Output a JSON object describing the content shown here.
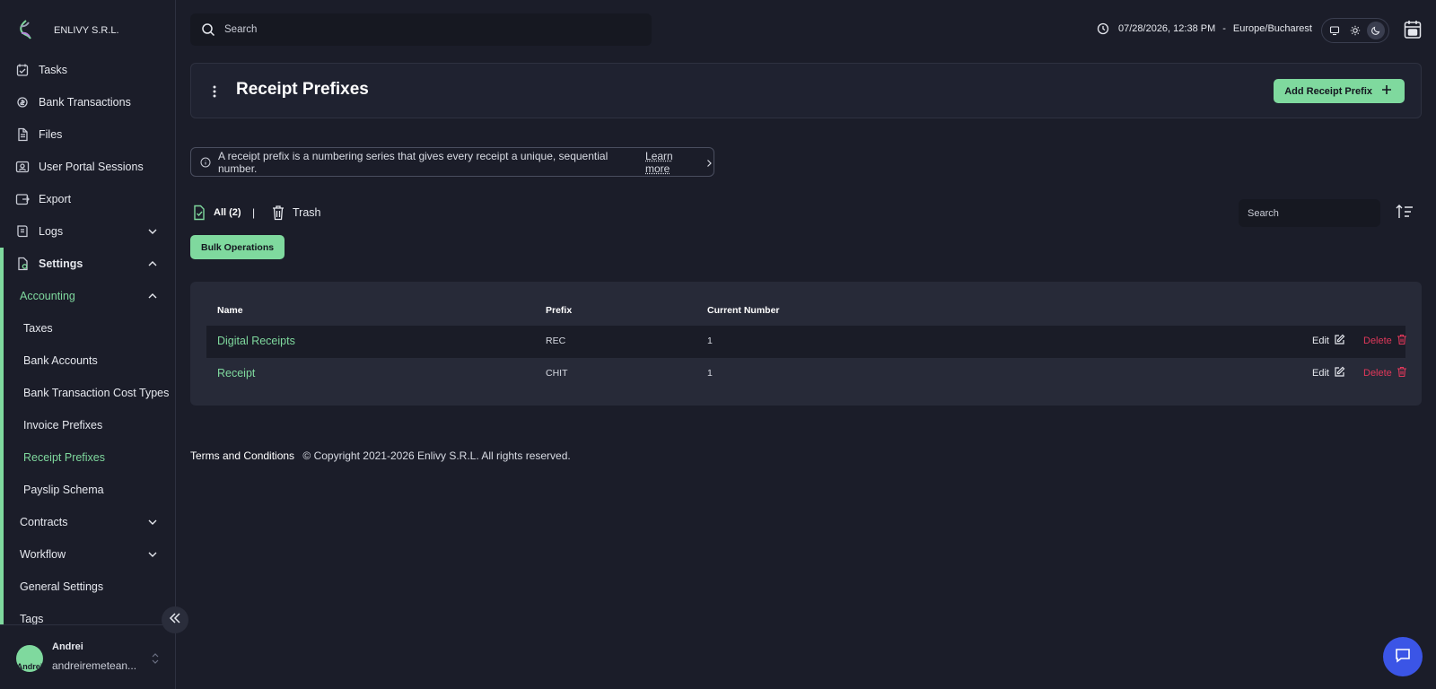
{
  "brand": {
    "name": "ENLIVY S.R.L."
  },
  "sidebar": {
    "items": [
      {
        "label": "Tasks",
        "icon": "tasks-icon"
      },
      {
        "label": "Bank Transactions",
        "icon": "bank-transactions-icon"
      },
      {
        "label": "Files",
        "icon": "file-icon"
      },
      {
        "label": "User Portal Sessions",
        "icon": "user-portal-icon"
      },
      {
        "label": "Export",
        "icon": "export-icon"
      },
      {
        "label": "Logs",
        "icon": "logs-icon"
      },
      {
        "label": "Settings",
        "icon": "settings-icon"
      }
    ],
    "settings_children": {
      "accounting": "Accounting",
      "accounting_items": [
        "Taxes",
        "Bank Accounts",
        "Bank Transaction Cost Types",
        "Invoice Prefixes",
        "Receipt Prefixes",
        "Payslip Schema"
      ],
      "contracts": "Contracts",
      "workflow": "Workflow",
      "general_settings": "General Settings",
      "tags": "Tags"
    },
    "active_item": "Receipt Prefixes"
  },
  "user": {
    "name": "Andrei",
    "email": "andreiremetean...",
    "avatar_text": "Andrei"
  },
  "topbar": {
    "search_placeholder": "Search",
    "datetime": "07/28/2026, 12:38 PM",
    "separator": "-",
    "timezone": "Europe/Bucharest",
    "theme_selected": "dark"
  },
  "page": {
    "title": "Receipt Prefixes",
    "add_button": "Add Receipt Prefix",
    "info_text": "A receipt prefix is a numbering series that gives every receipt a unique, sequential number.",
    "learn_more": "Learn more"
  },
  "filters": {
    "all_label": "All (2)",
    "separator": "|",
    "trash_label": "Trash",
    "search_placeholder": "Search",
    "bulk_button": "Bulk Operations"
  },
  "table": {
    "columns": [
      "Name",
      "Prefix",
      "Current Number"
    ],
    "rows": [
      {
        "name": "Digital Receipts",
        "prefix": "REC",
        "current_number": "1"
      },
      {
        "name": "Receipt",
        "prefix": "CHIT",
        "current_number": "1"
      }
    ],
    "edit_label": "Edit",
    "delete_label": "Delete"
  },
  "footer": {
    "terms": "Terms and Conditions",
    "copyright": "© Copyright 2021-2026 Enlivy S.R.L. All rights reserved."
  },
  "colors": {
    "accent": "#7fd99e",
    "background": "#1b1d29",
    "danger": "#e0385a",
    "chat": "#3b55e6"
  }
}
